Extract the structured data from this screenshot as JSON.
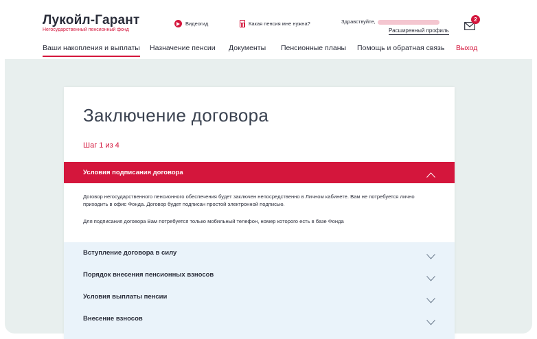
{
  "brand": {
    "title": "Лукойл-Гарант",
    "subtitle": "Негосударственный пенсионный фонд"
  },
  "header": {
    "video_label": "Видеогид",
    "calc_label": "Какая пенсия мне нужна?",
    "greeting": "Здравствуйте,",
    "profile_link": "Расширенный профиль",
    "notifications_count": "2"
  },
  "nav": {
    "items": [
      {
        "label": "Ваши накопления и выплаты"
      },
      {
        "label": "Назначение пенсии"
      },
      {
        "label": "Документы"
      },
      {
        "label": "Пенсионные планы"
      },
      {
        "label": "Помощь и обратная связь"
      }
    ],
    "exit_label": "Выход"
  },
  "main": {
    "title": "Заключение договора",
    "step": "Шаг 1 из 4",
    "open_section": {
      "title": "Условия подписания договора",
      "paragraph1": "Договор негосударственного пенсионного обеспечения будет заключен непосредственно в Личном кабинете. Вам не потребуется лично приходить в офис Фонда. Договор будет подписан простой электронной подписью.",
      "paragraph2": "Для подписания договора Вам потребуется только мобильный телефон, номер которого есть в базе Фонда"
    },
    "sections": [
      {
        "title": "Вступление договора в силу"
      },
      {
        "title": "Порядок внесения пенсионных взносов"
      },
      {
        "title": "Условия выплаты пенсии"
      },
      {
        "title": "Внесение взносов"
      }
    ]
  },
  "colors": {
    "accent": "#d4163c",
    "background": "#e8efee",
    "accordion_closed": "#eaf3fa",
    "text": "#2a2d3a"
  }
}
